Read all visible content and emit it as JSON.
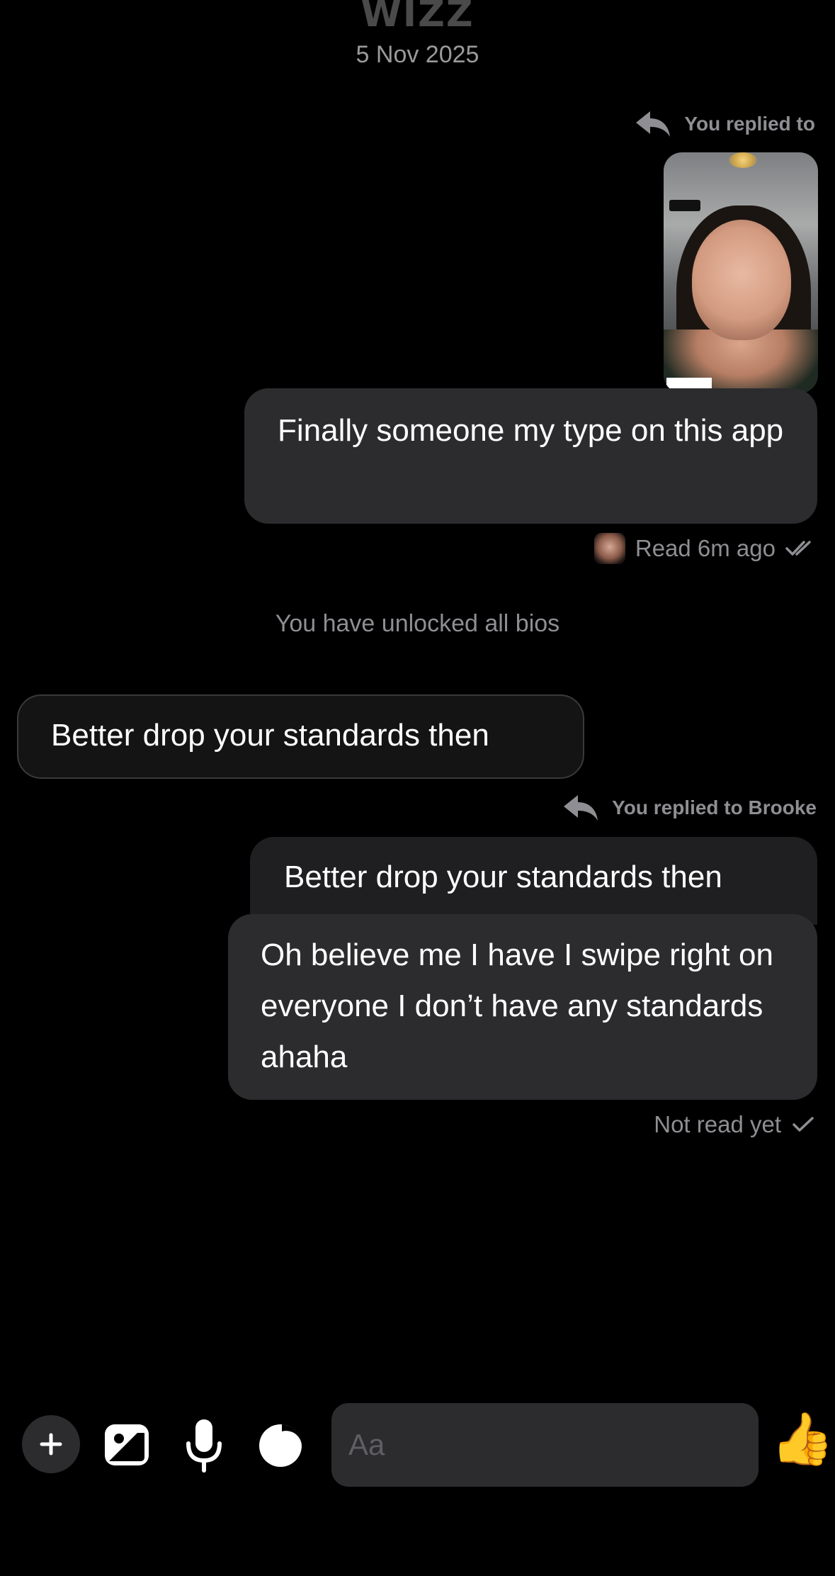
{
  "app": {
    "logo_text": "WIZZ",
    "date": "5 Nov 2025"
  },
  "messages": {
    "reply1": {
      "label": "You replied to",
      "text": "Finally someone my type on this app",
      "status": "Read 6m ago"
    },
    "system_notice": "You have unlocked all bios",
    "incoming1": {
      "text": "Better drop your standards then"
    },
    "reply2": {
      "label": "You replied to Brooke",
      "quoted_text": "Better drop your standards then",
      "text": "Oh believe me I have I swipe right on everyone I don’t have any standards ahaha",
      "status": "Not read yet"
    }
  },
  "composer": {
    "placeholder": "Aa",
    "icons": [
      "plus-icon",
      "image-icon",
      "microphone-icon",
      "moon-icon",
      "thumbs-up-icon"
    ],
    "thumb_emoji": "👍"
  },
  "colors": {
    "background": "#000000",
    "bubble": "#2c2c2e",
    "muted_text": "#8e8e93"
  }
}
